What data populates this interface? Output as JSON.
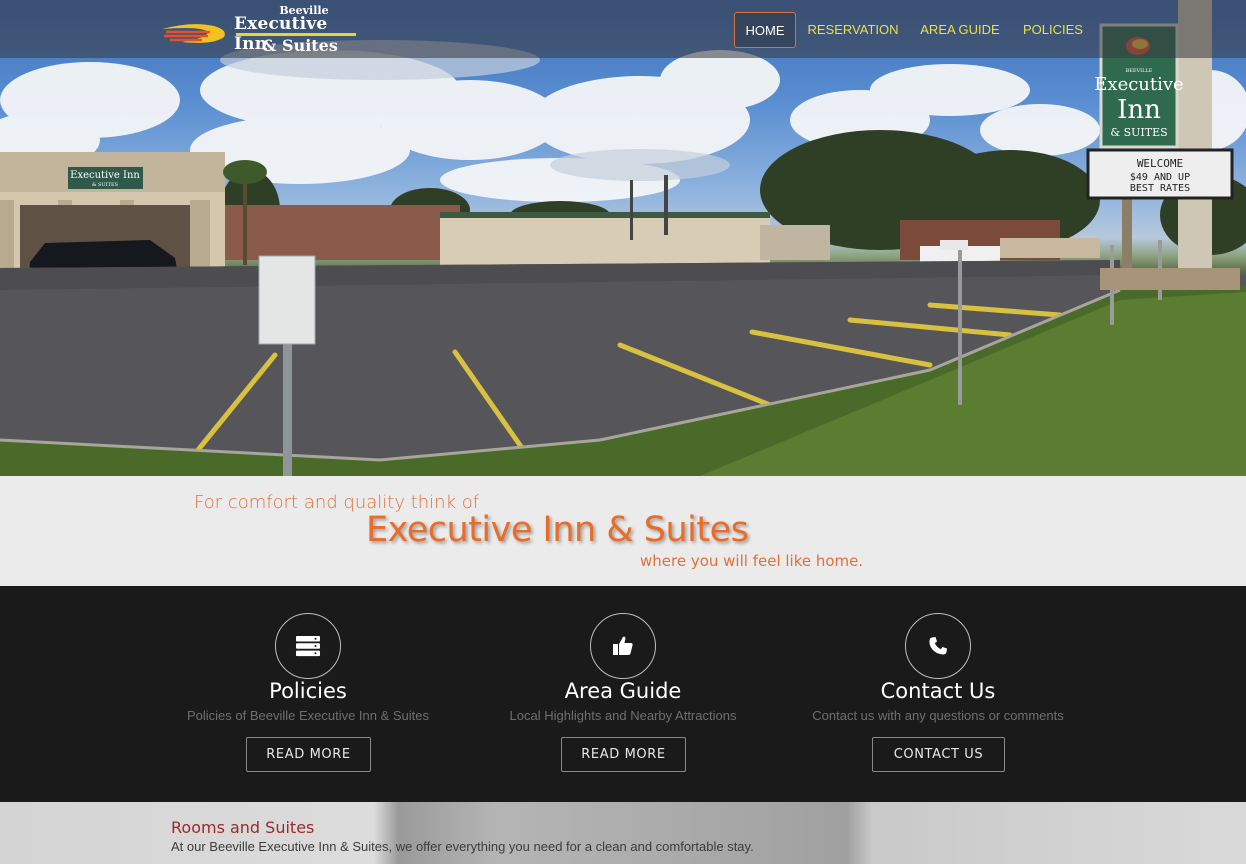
{
  "logo": {
    "line1": "Beeville",
    "line2": "Executive Inn",
    "line3": "& Suites"
  },
  "nav": {
    "items": [
      {
        "label": "HOME",
        "active": true
      },
      {
        "label": "RESERVATION",
        "active": false
      },
      {
        "label": "AREA GUIDE",
        "active": false
      },
      {
        "label": "POLICIES",
        "active": false
      }
    ]
  },
  "hero": {
    "building_sign": "Executive Inn",
    "building_sign_sub": "& SUITES",
    "pole_sign": {
      "top": "BEEVILLE",
      "name1": "Executive",
      "name2": "Inn",
      "name3": "& SUITES"
    },
    "marquee": {
      "line1": "WELCOME",
      "line2": "$49  AND  UP",
      "line3": "BEST  RATES"
    }
  },
  "tagline": {
    "line1": "For comfort and quality think of",
    "line2": "Executive Inn & Suites",
    "line3": "where you will feel like home."
  },
  "features": [
    {
      "icon": "server-icon",
      "title": "Policies",
      "desc": "Policies of Beeville Executive Inn & Suites",
      "button": "READ MORE"
    },
    {
      "icon": "thumbs-up-icon",
      "title": "Area Guide",
      "desc": "Local Highlights and Nearby Attractions",
      "button": "READ MORE"
    },
    {
      "icon": "phone-icon",
      "title": "Contact Us",
      "desc": "Contact us with any questions or comments",
      "button": "CONTACT US"
    }
  ],
  "rooms": {
    "title": "Rooms and Suites",
    "text": "At our Beeville Executive Inn & Suites, we offer everything you need for a clean and comfortable stay."
  },
  "colors": {
    "accent_orange": "#e86c2a",
    "nav_yellow": "#e9e04a",
    "dark_band": "#1a1a1a",
    "rooms_title": "#9b2b2b"
  }
}
